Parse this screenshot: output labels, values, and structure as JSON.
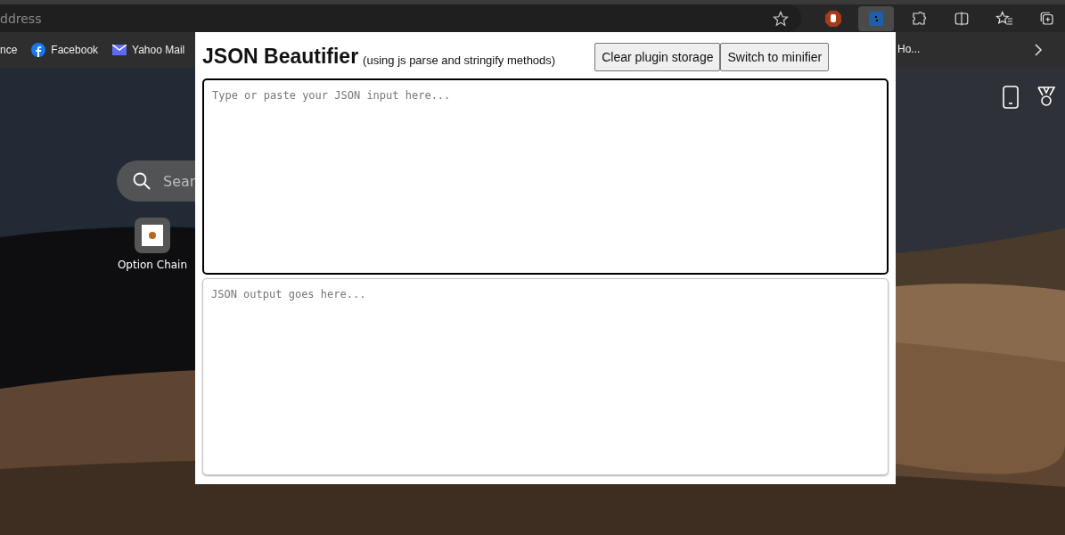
{
  "browser": {
    "address_text": "ddress",
    "bookmarks": [
      {
        "label": "nce",
        "kind": "plain"
      },
      {
        "label": "Facebook",
        "kind": "facebook"
      },
      {
        "label": "Yahoo Mail",
        "kind": "mail"
      },
      {
        "label": "Ho...",
        "kind": "plain"
      }
    ]
  },
  "new_tab": {
    "search_placeholder": "Sear",
    "shortcuts": [
      {
        "label": "Option Chain"
      }
    ]
  },
  "popup": {
    "title": "JSON Beautifier",
    "subtitle": "(using js parse and stringify methods)",
    "buttons": [
      {
        "label": "Clear plugin storage"
      },
      {
        "label": "Switch to minifier"
      }
    ],
    "input": {
      "placeholder": "Type or paste your JSON input here..."
    },
    "output": {
      "placeholder": "JSON output goes here..."
    }
  }
}
